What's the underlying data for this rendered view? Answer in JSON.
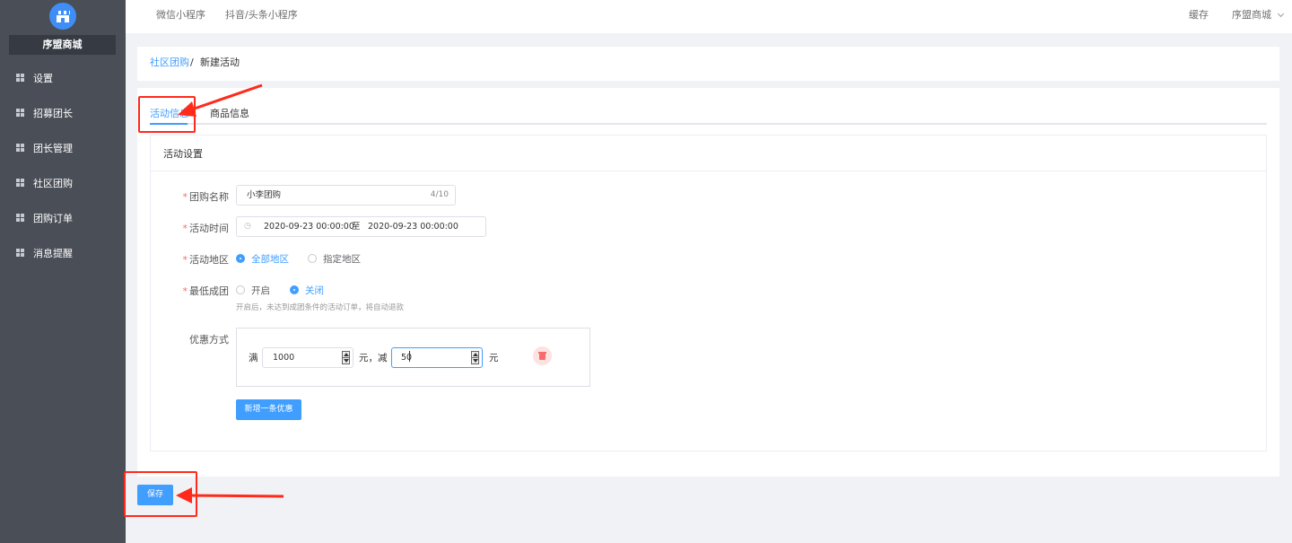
{
  "sidebar": {
    "shop_name": "序盟商城",
    "items": [
      {
        "label": "设置"
      },
      {
        "label": "招募团长"
      },
      {
        "label": "团长管理"
      },
      {
        "label": "社区团购"
      },
      {
        "label": "团购订单"
      },
      {
        "label": "消息提醒"
      }
    ]
  },
  "topbar": {
    "nav": [
      "微信小程序",
      "抖音/头条小程序"
    ],
    "cache": "缓存",
    "user": "序盟商城"
  },
  "breadcrumb": {
    "parent": "社区团购",
    "separator": "/",
    "current": "新建活动"
  },
  "tabs": [
    {
      "label": "活动信息",
      "active": true
    },
    {
      "label": "商品信息",
      "active": false
    }
  ],
  "section_title": "活动设置",
  "form": {
    "name": {
      "label": "团购名称",
      "value": "小李团购",
      "counter": "4/10"
    },
    "time": {
      "label": "活动时间",
      "start": "2020-09-23 00:00:00",
      "separator": "至",
      "end": "2020-09-23 00:00:00"
    },
    "region": {
      "label": "活动地区",
      "options": [
        "全部地区",
        "指定地区"
      ],
      "selected": "全部地区"
    },
    "min_group": {
      "label": "最低成团",
      "options": [
        "开启",
        "关闭"
      ],
      "selected": "关闭",
      "hint": "开启后，未达到成团条件的活动订单，将自动退款"
    },
    "discount": {
      "label": "优惠方式",
      "prefix": "满",
      "full_value": "1000",
      "mid": "元，减",
      "minus_value": "50",
      "suffix": "元",
      "add_button": "新增一条优惠"
    }
  },
  "save_button": "保存",
  "colors": {
    "sidebar_bg": "#4a4e57",
    "primary": "#409eff",
    "danger": "#f56c6c",
    "annotation": "#ff2a1a"
  }
}
